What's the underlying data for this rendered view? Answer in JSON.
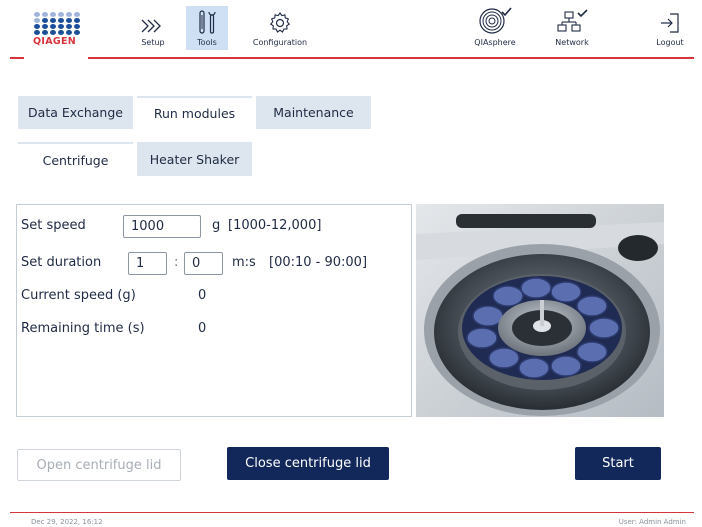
{
  "header": {
    "logo_text": "QIAGEN",
    "nav": {
      "setup": "Setup",
      "tools": "Tools",
      "configuration": "Configuration",
      "qiasphere": "QIAsphere",
      "network": "Network",
      "logout": "Logout"
    }
  },
  "tabs": {
    "primary": [
      "Data Exchange",
      "Run modules",
      "Maintenance"
    ],
    "secondary": [
      "Centrifuge",
      "Heater Shaker"
    ]
  },
  "panel": {
    "set_speed_label": "Set speed",
    "speed_value": "1000",
    "speed_unit": "g",
    "speed_range": "[1000-12,000]",
    "set_duration_label": "Set duration",
    "duration_minutes": "1",
    "duration_separator": ":",
    "duration_seconds": "0",
    "duration_unit": "m:s",
    "duration_range": "[00:10 - 90:00]",
    "current_speed_label": "Current speed (g)",
    "current_speed_value": "0",
    "remaining_time_label": "Remaining time (s)",
    "remaining_time_value": "0"
  },
  "buttons": {
    "open_lid": "Open centrifuge lid",
    "close_lid": "Close centrifuge lid",
    "start": "Start"
  },
  "footer": {
    "datetime": "Dec 29, 2022, 16:12",
    "user": "User: Admin Admin"
  },
  "colors": {
    "brand_red": "#d7343c",
    "brand_blue": "#1b4f9c",
    "primary_button": "#13285a",
    "active_nav": "#cfe0f4",
    "inactive_tab": "#dde6ee"
  }
}
